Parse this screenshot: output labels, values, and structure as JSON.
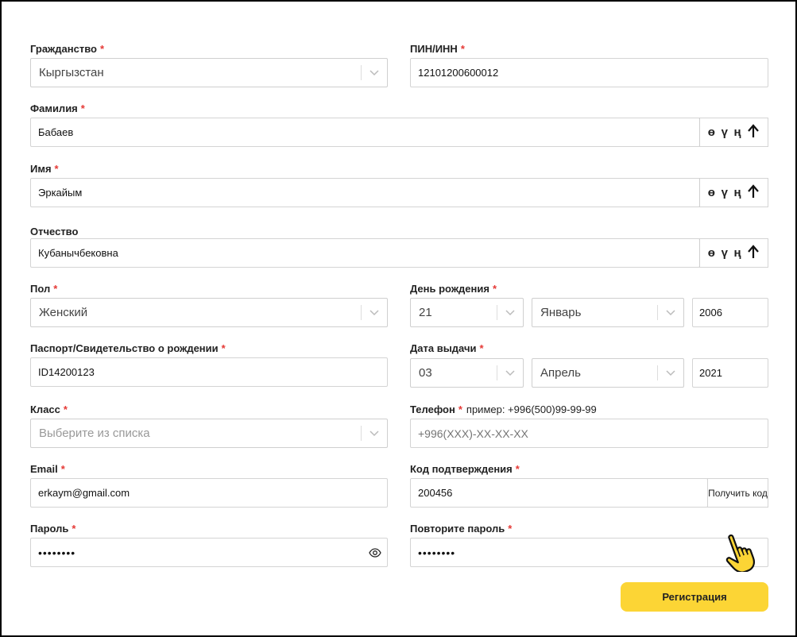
{
  "required_mark": "*",
  "citizenship": {
    "label": "Гражданство",
    "value": "Кыргызстан"
  },
  "pin": {
    "label": "ПИН/ИНН",
    "value": "12101200600012"
  },
  "surname": {
    "label": "Фамилия",
    "value": "Бабаев"
  },
  "name": {
    "label": "Имя",
    "value": "Эркайым"
  },
  "patronymic": {
    "label": "Отчество",
    "value": "Кубанычбековна"
  },
  "keyboard": {
    "k1": "ө",
    "k2": "ү",
    "k3": "ң",
    "shift": "🡡"
  },
  "gender": {
    "label": "Пол",
    "value": "Женский"
  },
  "birthday": {
    "label": "День рождения",
    "day": "21",
    "month": "Январь",
    "year": "2006"
  },
  "passport": {
    "label": "Паспорт/Свидетельство о рождении",
    "value": "ID14200123"
  },
  "issue_date": {
    "label": "Дата выдачи",
    "day": "03",
    "month": "Апрель",
    "year": "2021"
  },
  "class": {
    "label": "Класс",
    "placeholder": "Выберите из списка"
  },
  "phone": {
    "label": "Телефон",
    "hint": "пример: +996(500)99-99-99",
    "placeholder": "+996(XXX)-XX-XX-XX"
  },
  "email": {
    "label": "Email",
    "value": "erkaym@gmail.com"
  },
  "code": {
    "label": "Код подтверждения",
    "value": "200456",
    "button": "Получить код"
  },
  "password": {
    "label": "Пароль",
    "value": "••••••••"
  },
  "repeat_password": {
    "label": "Повторите пароль",
    "value": "••••••••"
  },
  "register_button": "Регистрация",
  "colors": {
    "accent": "#fcd535",
    "required": "#e53935"
  }
}
